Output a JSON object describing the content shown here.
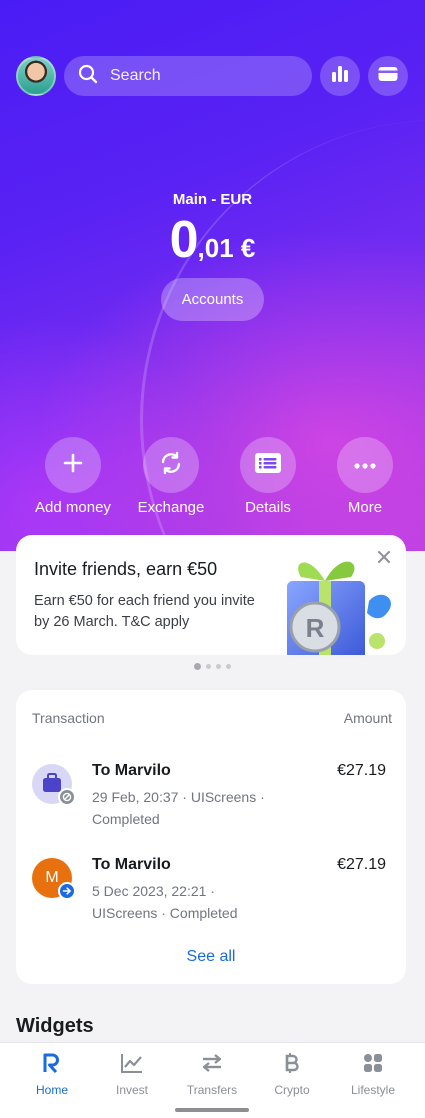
{
  "header": {
    "search_placeholder": "Search"
  },
  "balance": {
    "label": "Main - EUR",
    "whole": "0",
    "fraction": ",01 €",
    "accounts_button": "Accounts"
  },
  "actions": [
    {
      "label": "Add money",
      "icon": "plus-icon"
    },
    {
      "label": "Exchange",
      "icon": "exchange-icon"
    },
    {
      "label": "Details",
      "icon": "details-icon"
    },
    {
      "label": "More",
      "icon": "more-icon"
    }
  ],
  "promo": {
    "title": "Invite friends, earn €50",
    "text": "Earn €50 for each friend you invite by 26 March. T&C apply",
    "pager": {
      "pages": 4,
      "active": 1
    }
  },
  "transactions": {
    "header_left": "Transaction",
    "header_right": "Amount",
    "items": [
      {
        "name": "To Marvilo",
        "meta": "29 Feb, 20:37 · UIScreens · Completed",
        "amount": "€27.19",
        "icon": "briefcase-icon",
        "badge": "cancel-badge-icon"
      },
      {
        "name": "To Marvilo",
        "meta": "5 Dec 2023, 22:21 · UIScreens · Completed",
        "amount": "€27.19",
        "icon_letter": "M",
        "badge": "transfer-badge-icon"
      }
    ],
    "see_all": "See all"
  },
  "widgets": {
    "title": "Widgets"
  },
  "tabbar": {
    "tabs": [
      {
        "label": "Home",
        "active": true
      },
      {
        "label": "Invest"
      },
      {
        "label": "Transfers"
      },
      {
        "label": "Crypto"
      },
      {
        "label": "Lifestyle"
      }
    ]
  },
  "colors": {
    "accent": "#1a6ae0",
    "hero_start": "#4a1cf5",
    "hero_end": "#b13ee6",
    "tx_letter_icon": "#e8700f"
  }
}
